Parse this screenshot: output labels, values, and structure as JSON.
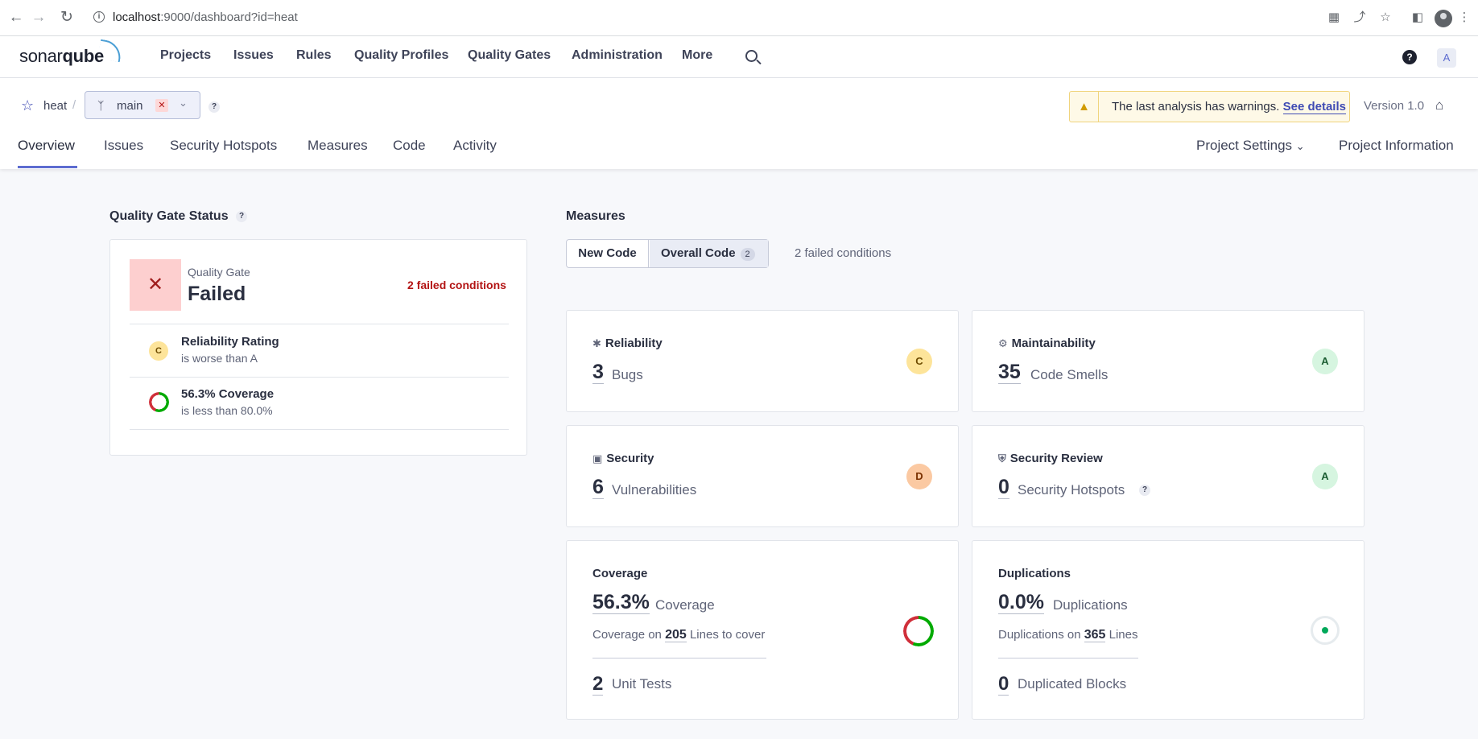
{
  "browser": {
    "url_host": "localhost",
    "url_rest": ":9000/dashboard?id=heat"
  },
  "nav": {
    "logo_a": "sonar",
    "logo_b": "qube",
    "items": [
      "Projects",
      "Issues",
      "Rules",
      "Quality Profiles",
      "Quality Gates",
      "Administration",
      "More"
    ],
    "user_initial": "A"
  },
  "project": {
    "name": "heat",
    "branch": "main",
    "warning_text": "The last analysis has warnings.",
    "warning_link": "See details",
    "version": "Version 1.0",
    "tabs": [
      "Overview",
      "Issues",
      "Security Hotspots",
      "Measures",
      "Code",
      "Activity"
    ],
    "settings": "Project Settings",
    "information": "Project Information"
  },
  "quality_gate": {
    "title": "Quality Gate Status",
    "label": "Quality Gate",
    "status": "Failed",
    "failed_count": "2 failed conditions",
    "conditions": [
      {
        "rating": "C",
        "title": "Reliability Rating",
        "sub": "is worse than A"
      },
      {
        "title": "56.3% Coverage",
        "sub": "is less than 80.0%",
        "coverage": 56.3
      }
    ]
  },
  "measures": {
    "title": "Measures",
    "tab_new": "New Code",
    "tab_overall": "Overall Code",
    "tab_overall_badge": "2",
    "failed_conditions": "2 failed conditions",
    "reliability": {
      "head": "Reliability",
      "value": "3",
      "unit": "Bugs",
      "rating": "C"
    },
    "maintainability": {
      "head": "Maintainability",
      "value": "35",
      "unit": "Code Smells",
      "rating": "A"
    },
    "security": {
      "head": "Security",
      "value": "6",
      "unit": "Vulnerabilities",
      "rating": "D"
    },
    "security_review": {
      "head": "Security Review",
      "value": "0",
      "unit": "Security Hotspots",
      "rating": "A"
    },
    "coverage": {
      "head": "Coverage",
      "value": "56.3%",
      "unit": "Coverage",
      "lines_prefix": "Coverage on",
      "lines_value": "205",
      "lines_suffix": "Lines to cover",
      "tests_value": "2",
      "tests_unit": "Unit Tests",
      "percent": 56.3
    },
    "duplications": {
      "head": "Duplications",
      "value": "0.0%",
      "unit": "Duplications",
      "lines_prefix": "Duplications on",
      "lines_value": "365",
      "lines_suffix": "Lines",
      "blocks_value": "0",
      "blocks_unit": "Duplicated Blocks"
    }
  },
  "colors": {
    "accent": "#5d6cd0",
    "fail": "#b31414",
    "good": "#00aa00"
  }
}
